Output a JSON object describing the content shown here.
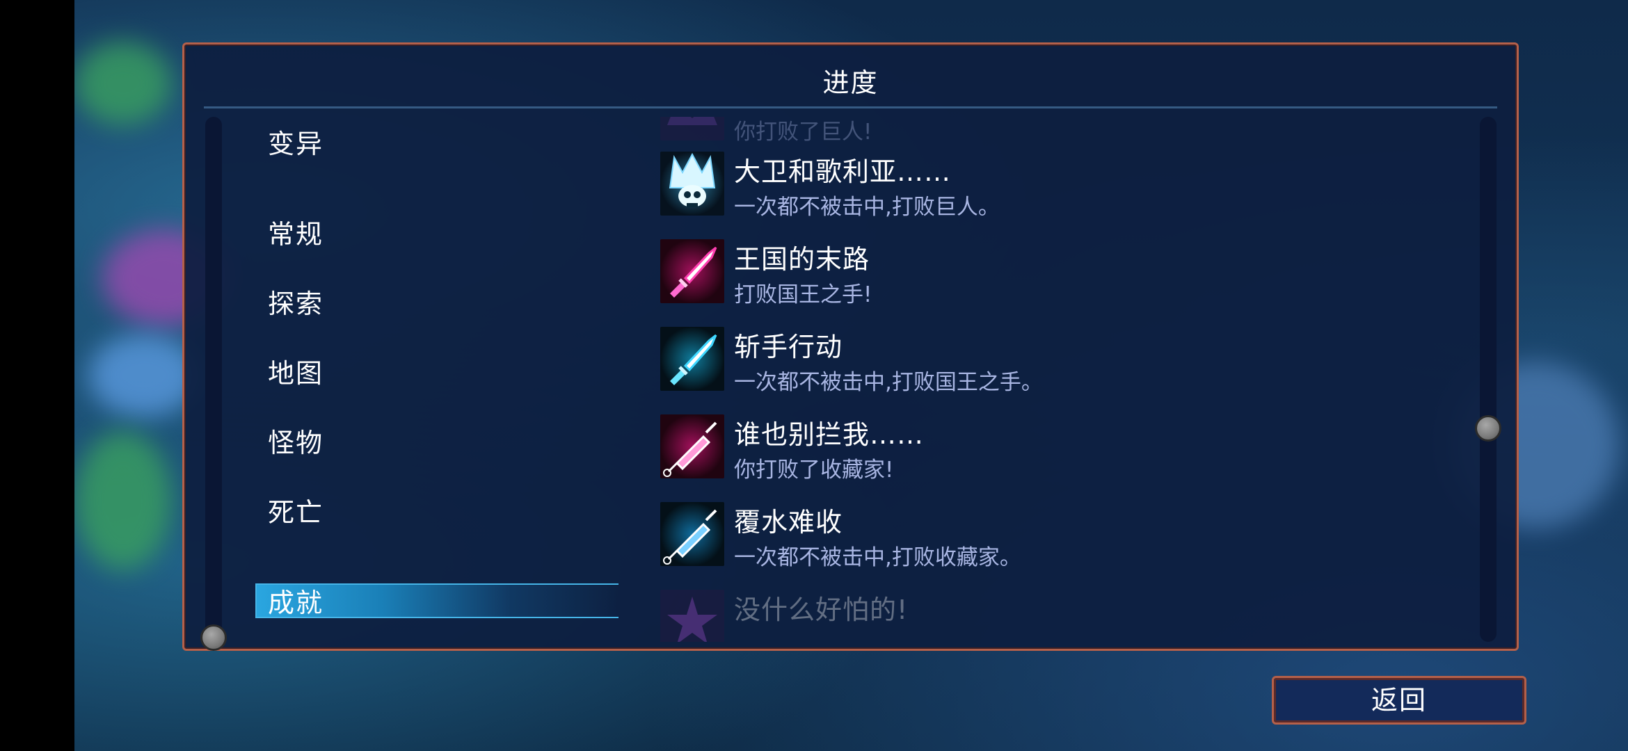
{
  "panel": {
    "title": "进度"
  },
  "categories": [
    {
      "label": "变异"
    },
    {
      "label": "常规"
    },
    {
      "label": "探索"
    },
    {
      "label": "地图"
    },
    {
      "label": "怪物"
    },
    {
      "label": "死亡"
    },
    {
      "label": "成就",
      "selected": true
    }
  ],
  "achievements": [
    {
      "title": "",
      "desc": "你打败了巨人!",
      "icon": "crown-icon",
      "color": "#7a3aa0",
      "partial": true
    },
    {
      "title": "大卫和歌利亚……",
      "desc": "一次都不被击中,打败巨人。",
      "icon": "skull-crown-icon",
      "color": "#bfefff"
    },
    {
      "title": "王国的末路",
      "desc": "打败国王之手!",
      "icon": "blade-icon",
      "color": "#ff3fb0"
    },
    {
      "title": "斩手行动",
      "desc": "一次都不被击中,打败国王之手。",
      "icon": "blade-icon",
      "color": "#3fd7ff"
    },
    {
      "title": "谁也别拦我……",
      "desc": "你打败了收藏家!",
      "icon": "syringe-icon",
      "color": "#ff3fb0"
    },
    {
      "title": "覆水难收",
      "desc": "一次都不被击中,打败收藏家。",
      "icon": "syringe-icon",
      "color": "#3fb8ff"
    },
    {
      "title": "没什么好怕的!",
      "desc": "",
      "icon": "star-icon",
      "color": "#b04ad0",
      "partial": true
    }
  ],
  "footer": {
    "back_label": "返回"
  }
}
